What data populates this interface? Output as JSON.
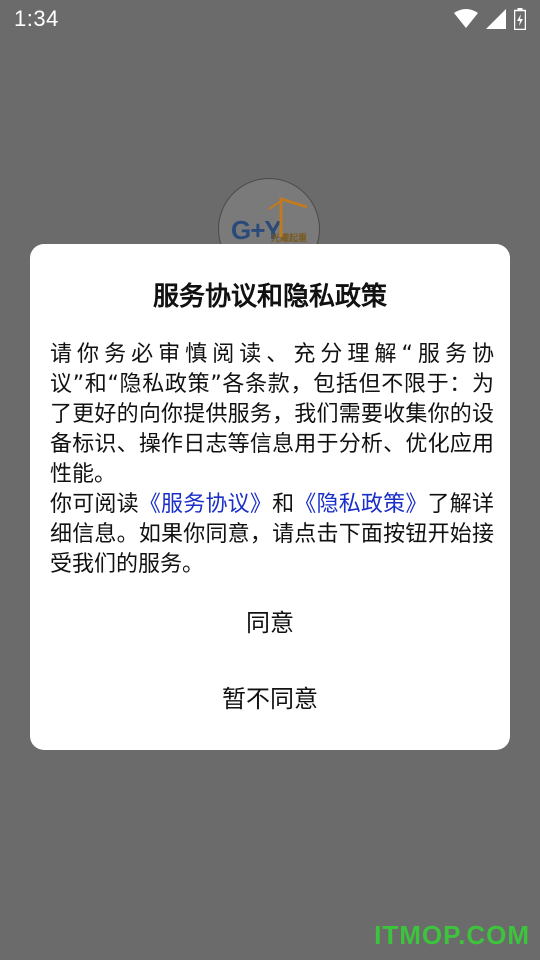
{
  "status_bar": {
    "time": "1:34",
    "icons": [
      "wifi-icon",
      "signal-icon",
      "battery-icon"
    ]
  },
  "logo": {
    "text": "G+Y",
    "subtext": "光耀起重"
  },
  "dialog": {
    "title": "服务协议和隐私政策",
    "paragraph1": "请你务必审慎阅读、充分理解“服务协议”和“隐私政策”各条款，包括但不限于：为了更好的向你提供服务，我们需要收集你的设备标识、操作日志等信息用于分析、优化应用性能。",
    "paragraph2_prefix": "你可阅读",
    "service_link": "《服务协议》",
    "paragraph2_and": "和",
    "privacy_link": "《隐私政策》",
    "paragraph2_suffix": "了解详细信息。如果你同意，请点击下面按钮开始接受我们的服务。",
    "agree_label": "同意",
    "disagree_label": "暂不同意"
  },
  "watermark": "ITMOP.COM",
  "colors": {
    "overlay": "#6b6b6b",
    "link": "#1a2ec8",
    "watermark": "#3cc43c"
  }
}
